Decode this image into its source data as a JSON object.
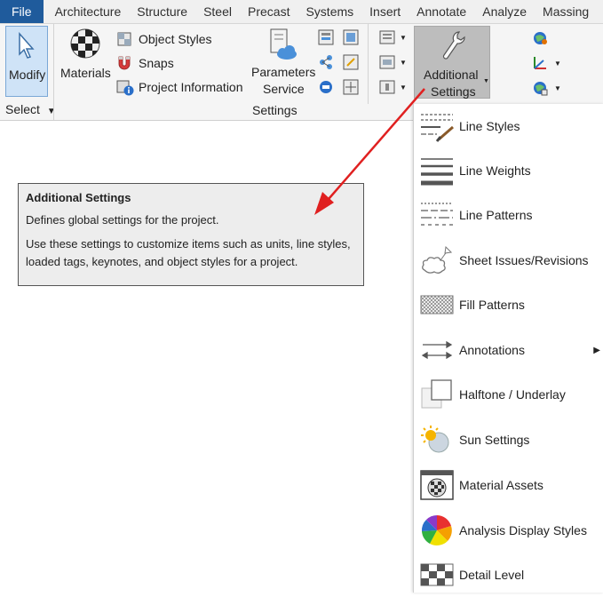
{
  "tabs": [
    "File",
    "Architecture",
    "Structure",
    "Steel",
    "Precast",
    "Systems",
    "Insert",
    "Annotate",
    "Analyze",
    "Massing"
  ],
  "ribbon": {
    "modify_label": "Modify",
    "select_label": "Select",
    "materials_label": "Materials",
    "object_styles_label": "Object  Styles",
    "snaps_label": "Snaps",
    "project_information_label": "Project  Information",
    "parameters_service_label_1": "Parameters",
    "parameters_service_label_2": "Service",
    "settings_panel_title": "Settings",
    "additional_settings_label_1": "Additional",
    "additional_settings_label_2": "Settings"
  },
  "tooltip": {
    "title": "Additional Settings",
    "line1": "Defines global settings for the project.",
    "line2": "Use these settings to customize items such as units, line styles, loaded tags, keynotes, and object styles for a project."
  },
  "menu": {
    "items": [
      {
        "label": "Line Styles",
        "icon": "line-styles-icon"
      },
      {
        "label": "Line Weights",
        "icon": "line-weights-icon"
      },
      {
        "label": "Line Patterns",
        "icon": "line-patterns-icon"
      },
      {
        "label": "Sheet Issues/Revisions",
        "icon": "revision-cloud-icon"
      },
      {
        "label": "Fill Patterns",
        "icon": "fill-patterns-icon"
      },
      {
        "label": "Annotations",
        "icon": "annotations-icon"
      },
      {
        "label": "Halftone / Underlay",
        "icon": "halftone-icon"
      },
      {
        "label": "Sun Settings",
        "icon": "sun-settings-icon"
      },
      {
        "label": "Material Assets",
        "icon": "material-assets-icon"
      },
      {
        "label": "Analysis Display Styles",
        "icon": "analysis-display-icon"
      },
      {
        "label": "Detail Level",
        "icon": "detail-level-icon"
      }
    ]
  },
  "colors": {
    "file_tab": "#1f5b9c",
    "arrow": "#e02020",
    "modify_bg": "#cfe3f7"
  }
}
